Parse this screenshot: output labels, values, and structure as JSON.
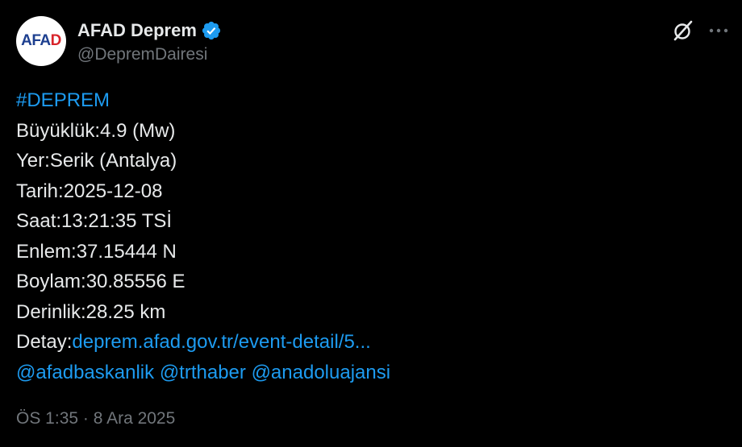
{
  "author": {
    "display_name": "AFAD Deprem",
    "handle": "@DepremDairesi",
    "avatar_text_a": "AFA",
    "avatar_text_b": "D",
    "verified_icon": "verified-badge-icon",
    "verified_color": "#1d9bf0"
  },
  "header_actions": {
    "grok_icon": "grok-icon",
    "more_icon": "more-horizontal-icon"
  },
  "tweet": {
    "hashtag": "#DEPREM",
    "magnitude": "Büyüklük:4.9 (Mw)",
    "location": "Yer:Serik (Antalya)",
    "date": "Tarih:2025-12-08",
    "time": "Saat:13:21:35 TSİ",
    "latitude": "Enlem:37.15444 N",
    "longitude": "Boylam:30.85556 E",
    "depth": "Derinlik:28.25 km",
    "detail_label": "Detay:",
    "detail_link": "deprem.afad.gov.tr/event-detail/5...",
    "mentions": [
      "@afadbaskanlik",
      "@trthaber",
      "@anadoluajansi"
    ],
    "timestamp": "ÖS 1:35 · 8 Ara 2025"
  },
  "colors": {
    "background": "#000000",
    "text": "#e7e9ea",
    "secondary": "#71767b",
    "link": "#1d9bf0"
  }
}
